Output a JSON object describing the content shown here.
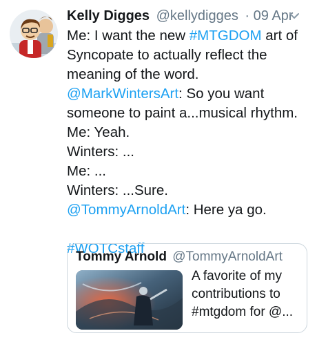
{
  "tweet": {
    "author_name": "Kelly Digges",
    "author_handle": "@kellydigges",
    "date": "· 09 Apr",
    "lines": [
      [
        {
          "t": "Me: I want the new "
        },
        {
          "t": "#MTGDOM",
          "link": true
        },
        {
          "t": " art of"
        }
      ],
      [
        {
          "t": "Syncopate to actually reflect the"
        }
      ],
      [
        {
          "t": "meaning of the word."
        }
      ],
      [
        {
          "t": "@MarkWintersArt",
          "link": true
        },
        {
          "t": ": So you want"
        }
      ],
      [
        {
          "t": "someone to paint a...musical rhythm."
        }
      ],
      [
        {
          "t": "Me: Yeah."
        }
      ],
      [
        {
          "t": "Winters: ..."
        }
      ],
      [
        {
          "t": "Me: ..."
        }
      ],
      [
        {
          "t": "Winters: ...Sure."
        }
      ],
      [
        {
          "t": "@TommyArnoldArt",
          "link": true
        },
        {
          "t": ": Here ya go."
        }
      ],
      [
        {
          "t": ""
        }
      ],
      [
        {
          "t": "#WOTCstaff",
          "link": true
        }
      ]
    ]
  },
  "quoted": {
    "author_name": "Tommy Arnold",
    "author_handle": "@TommyArnoldArt",
    "lines": [
      "A favorite of my",
      "contributions to",
      "#mtgdom for @..."
    ]
  },
  "colors": {
    "link": "#1da1f2",
    "text": "#14171a",
    "meta": "#657786",
    "border": "#ccd6dd"
  },
  "icons": {
    "menu": "chevron-down-icon",
    "avatar": "cartoon-avatar-image",
    "artwork": "fantasy-artwork-image"
  }
}
